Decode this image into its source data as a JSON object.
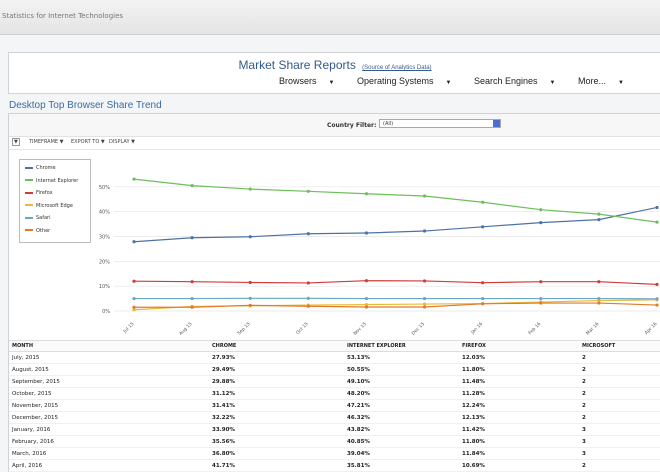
{
  "window": {
    "site_title": "Statistics for Internet Technologies"
  },
  "header": {
    "title": "Market Share Reports",
    "source_link": "(Source of Analytics Data)",
    "nav": [
      "Browsers",
      "Operating Systems",
      "Search Engines",
      "More..."
    ]
  },
  "section_title": "Desktop Top Browser Share Trend",
  "filter": {
    "label": "Country Filter:",
    "value": "(All)"
  },
  "toolbar": {
    "first": "▼",
    "items": [
      "TIMEFRAME",
      "EXPORT TO",
      "DISPLAY"
    ]
  },
  "colors": {
    "chrome": "#4d72a4",
    "ie": "#6cbf5a",
    "firefox": "#d23b3b",
    "edge": "#e8b93a",
    "safari": "#6aa7c4",
    "other": "#e07b2a"
  },
  "chart_data": {
    "type": "line",
    "x": [
      "Jul 15",
      "Aug 15",
      "Sep 15",
      "Oct 15",
      "Nov 15",
      "Dec 15",
      "Jan 16",
      "Feb 16",
      "Mar 16",
      "Apr 16"
    ],
    "ylim": [
      0,
      60
    ],
    "yticks": [
      "0%",
      "10%",
      "20%",
      "30%",
      "40%",
      "50%"
    ],
    "grid": true,
    "legend_position": "top-left",
    "series": [
      {
        "name": "Chrome",
        "key": "chrome",
        "values": [
          27.9,
          29.5,
          29.9,
          31.1,
          31.4,
          32.2,
          33.9,
          35.6,
          36.8,
          41.7
        ]
      },
      {
        "name": "Internet Explorer",
        "key": "ie",
        "values": [
          53.1,
          50.5,
          49.1,
          48.2,
          47.2,
          46.3,
          43.8,
          40.8,
          39.0,
          35.8
        ]
      },
      {
        "name": "Firefox",
        "key": "firefox",
        "values": [
          12.0,
          11.8,
          11.5,
          11.3,
          12.2,
          12.1,
          11.4,
          11.8,
          11.8,
          10.7
        ]
      },
      {
        "name": "Microsoft Edge",
        "key": "edge",
        "values": [
          0.5,
          1.8,
          2.1,
          2.4,
          2.6,
          2.8,
          3.0,
          3.6,
          4.2,
          4.5
        ]
      },
      {
        "name": "Safari",
        "key": "safari",
        "values": [
          5.0,
          5.0,
          5.1,
          5.1,
          5.0,
          5.0,
          5.0,
          5.0,
          5.0,
          4.9
        ]
      },
      {
        "name": "Other",
        "key": "other",
        "values": [
          1.5,
          1.5,
          2.3,
          1.9,
          1.6,
          1.6,
          2.9,
          3.2,
          3.2,
          2.4
        ]
      }
    ]
  },
  "table": {
    "headers": [
      "MONTH",
      "CHROME",
      "INTERNET EXPLORER",
      "FIREFOX",
      "MICROSOFT"
    ],
    "rows": [
      [
        "July, 2015",
        "27.93%",
        "53.13%",
        "12.03%",
        "2"
      ],
      [
        "August, 2015",
        "29.49%",
        "50.55%",
        "11.80%",
        "2"
      ],
      [
        "September, 2015",
        "29.88%",
        "49.10%",
        "11.48%",
        "2"
      ],
      [
        "October, 2015",
        "31.12%",
        "48.20%",
        "11.28%",
        "2"
      ],
      [
        "November, 2015",
        "31.41%",
        "47.21%",
        "12.24%",
        "2"
      ],
      [
        "December, 2015",
        "32.22%",
        "46.32%",
        "12.13%",
        "2"
      ],
      [
        "January, 2016",
        "33.90%",
        "43.82%",
        "11.42%",
        "3"
      ],
      [
        "February, 2016",
        "35.56%",
        "40.85%",
        "11.80%",
        "3"
      ],
      [
        "March, 2016",
        "36.80%",
        "39.04%",
        "11.84%",
        "3"
      ],
      [
        "April, 2016",
        "41.71%",
        "35.81%",
        "10.69%",
        "2"
      ]
    ]
  }
}
